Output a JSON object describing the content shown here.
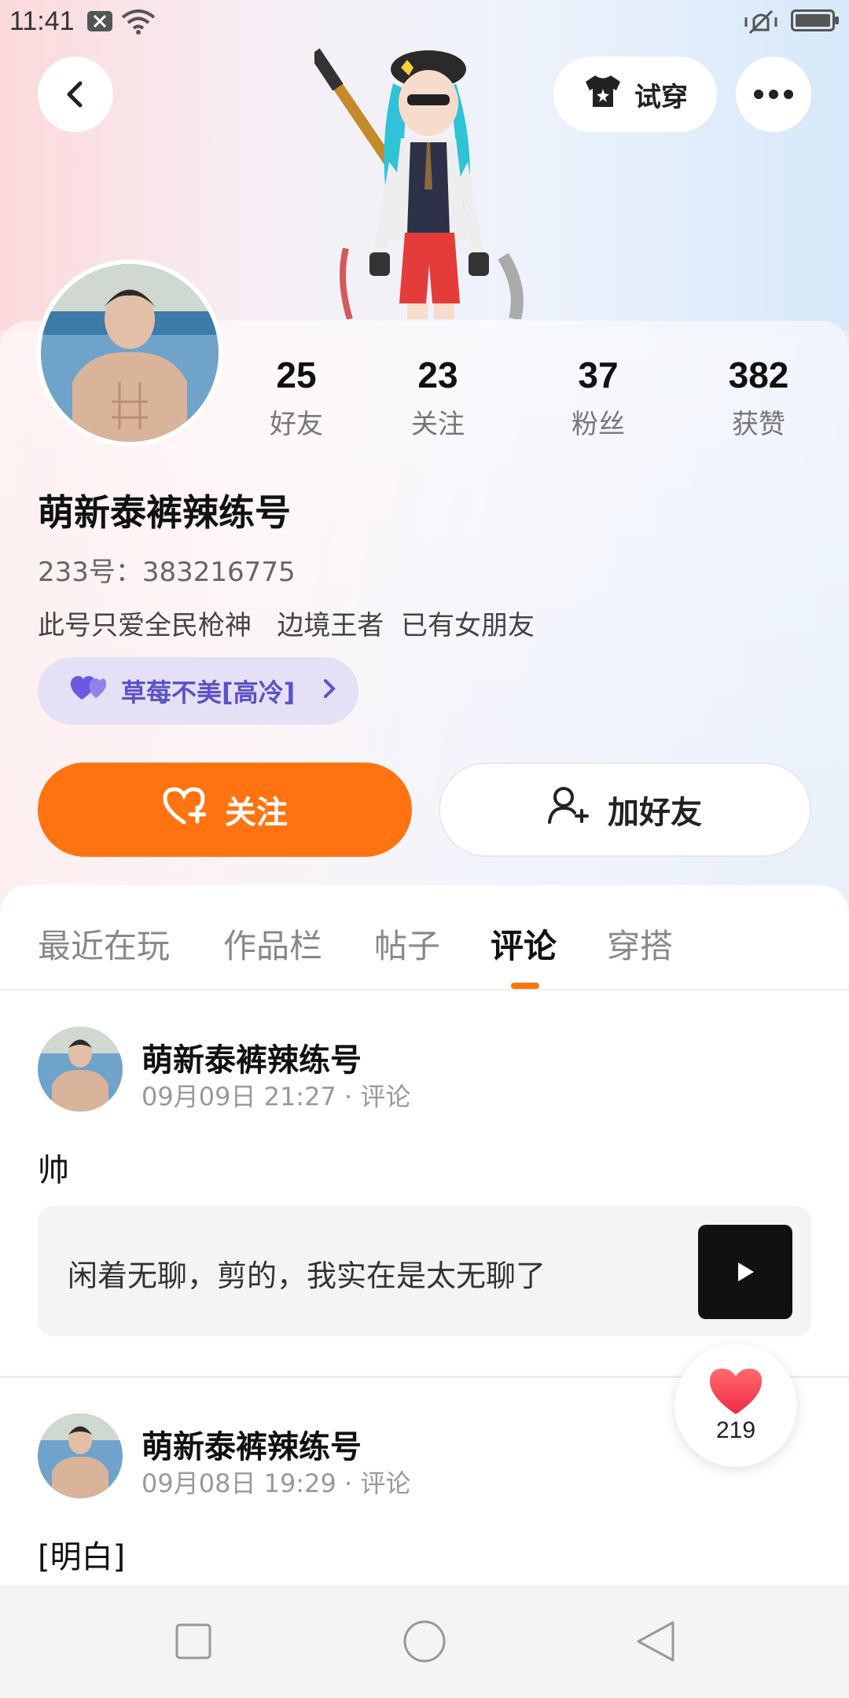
{
  "status_bar": {
    "time": "11:41"
  },
  "header": {
    "try_on_label": "试穿"
  },
  "stats": [
    {
      "value": "25",
      "label": "好友"
    },
    {
      "value": "23",
      "label": "关注"
    },
    {
      "value": "37",
      "label": "粉丝"
    },
    {
      "value": "382",
      "label": "获赞"
    }
  ],
  "profile": {
    "nickname": "萌新泰裤辣练号",
    "uid": "233号：383216775",
    "bio": "此号只爱全民枪神   边境王者  已有女朋友",
    "tag_label": "草莓不美[高冷]"
  },
  "actions": {
    "follow_label": "关注",
    "add_friend_label": "加好友"
  },
  "tabs": [
    {
      "label": "最近在玩"
    },
    {
      "label": "作品栏"
    },
    {
      "label": "帖子"
    },
    {
      "label": "评论"
    },
    {
      "label": "穿搭"
    }
  ],
  "comments": [
    {
      "author": "萌新泰裤辣练号",
      "meta": "09月09日 21:27 · 评论",
      "text": "帅",
      "quote": "闲着无聊，剪的，我实在是太无聊了"
    },
    {
      "author": "萌新泰裤辣练号",
      "meta": "09月08日 19:29 · 评论",
      "text": "[明白]"
    }
  ],
  "like_fab": {
    "count": "219"
  },
  "colors": {
    "accent": "#ff7411",
    "tag_text": "#5a52c8",
    "tag_bg": "#e6e0f6"
  }
}
